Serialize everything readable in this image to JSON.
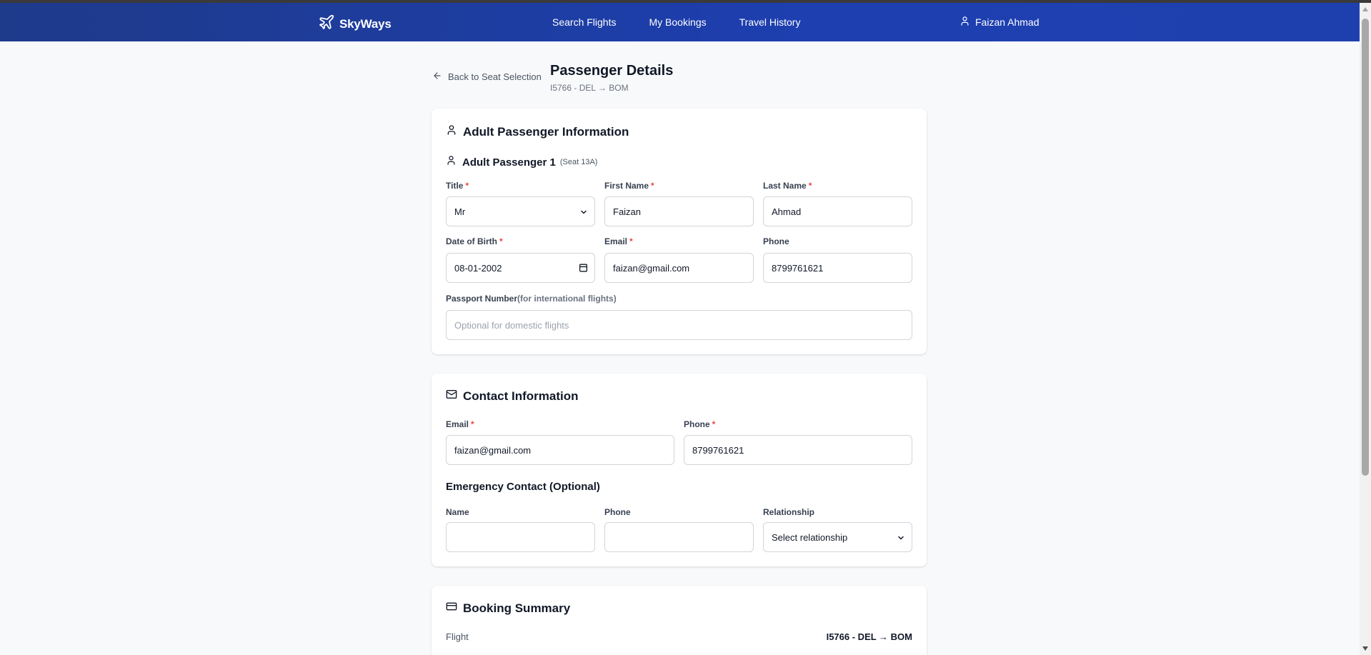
{
  "nav": {
    "brand": "SkyWays",
    "links": [
      "Search Flights",
      "My Bookings",
      "Travel History"
    ],
    "user": "Faizan Ahmad"
  },
  "header": {
    "back_label": "Back to Seat Selection",
    "title": "Passenger Details",
    "subtitle": "I5766 - DEL → BOM"
  },
  "adult_section": {
    "title": "Adult Passenger Information",
    "passenger_label": "Adult Passenger 1",
    "seat_note": "(Seat 13A)",
    "fields": {
      "title_label": "Title",
      "title_value": "Mr",
      "first_name_label": "First Name",
      "first_name_value": "Faizan",
      "last_name_label": "Last Name",
      "last_name_value": "Ahmad",
      "dob_label": "Date of Birth",
      "dob_value": "08-01-2002",
      "email_label": "Email",
      "email_value": "faizan@gmail.com",
      "phone_label": "Phone",
      "phone_value": "8799761621",
      "passport_label": "Passport Number",
      "passport_hint": "(for international flights)",
      "passport_placeholder": "Optional for domestic flights"
    }
  },
  "contact_section": {
    "title": "Contact Information",
    "email_label": "Email",
    "email_value": "faizan@gmail.com",
    "phone_label": "Phone",
    "phone_value": "8799761621",
    "emergency_title": "Emergency Contact (Optional)",
    "name_label": "Name",
    "em_phone_label": "Phone",
    "relationship_label": "Relationship",
    "relationship_value": "Select relationship"
  },
  "summary_section": {
    "title": "Booking Summary",
    "flight_label": "Flight",
    "flight_value": "I5766 - DEL → BOM"
  },
  "required_mark": "*",
  "colors": {
    "nav_bg": "#1e40af",
    "required": "#ef4444",
    "page_bg": "#f8f9fb"
  },
  "icons": {
    "brand": "plane-icon",
    "user": "user-icon",
    "back": "arrow-left-icon",
    "passenger": "user-icon",
    "contact": "mail-icon",
    "summary": "credit-card-icon",
    "select": "chevron-down-icon",
    "date": "calendar-icon"
  }
}
